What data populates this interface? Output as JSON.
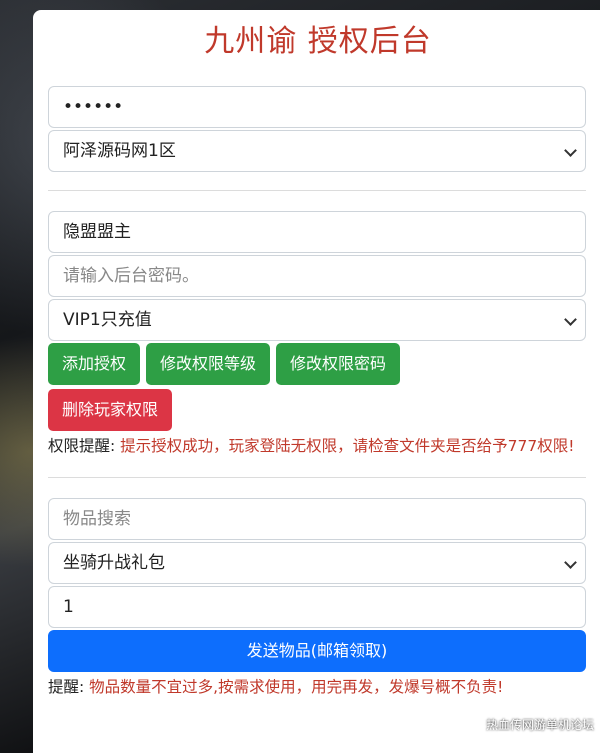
{
  "title": "九州谕 授权后台",
  "server_section": {
    "password_value": "••••••",
    "server_select": "阿泽源码网1区"
  },
  "auth_section": {
    "player_name": "隐盟盟主",
    "password_placeholder": "请输入后台密码。",
    "vip_select": "VIP1只充值",
    "buttons": {
      "add_auth": "添加授权",
      "modify_level": "修改权限等级",
      "modify_password": "修改权限密码",
      "delete_auth": "删除玩家权限"
    },
    "notice_label": "权限提醒:",
    "notice_message": "提示授权成功，玩家登陆无权限，请检查文件夹是否给予777权限!"
  },
  "item_section": {
    "search_placeholder": "物品搜索",
    "item_select": "坐骑升战礼包",
    "quantity": "1",
    "send_button": "发送物品(邮箱领取)",
    "notice_label": "提醒:",
    "notice_message": "物品数量不宜过多,按需求使用，用完再发，发爆号概不负责!"
  },
  "watermark": "热血传网游单机论坛"
}
